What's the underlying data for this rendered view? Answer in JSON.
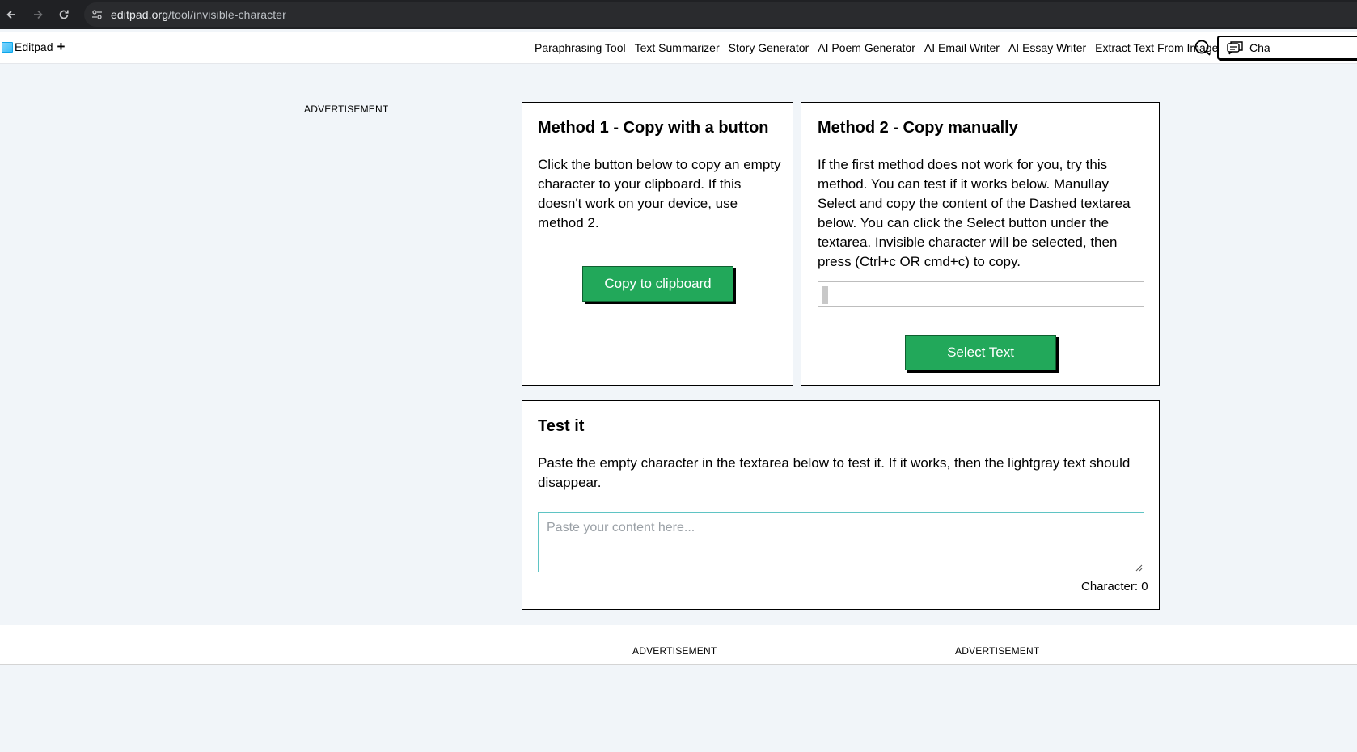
{
  "browser": {
    "url_host": "editpad.org",
    "url_path": "/tool/invisible-character"
  },
  "header": {
    "logo_text": "Editpad",
    "logo_plus": "+",
    "nav": [
      "Paraphrasing Tool",
      "Text Summarizer",
      "Story Generator",
      "AI Poem Generator",
      "AI Email Writer",
      "AI Essay Writer",
      "Extract Text From Image"
    ],
    "chat_label": "Cha"
  },
  "ads": {
    "left": "ADVERTISEMENT",
    "bottom_1": "ADVERTISEMENT",
    "bottom_2": "ADVERTISEMENT"
  },
  "method1": {
    "title": "Method 1 - Copy with a button",
    "body": "Click the button below to copy an empty character to your clipboard. If this doesn't work on your device, use method 2.",
    "button": "Copy to clipboard"
  },
  "method2": {
    "title": "Method 2 - Copy manually",
    "body": "If the first method does not work for you, try this method. You can test if it works below. Manullay Select and copy the content of the Dashed textarea below. You can click the Select button under the textarea. Invisible character will be selected, then press (Ctrl+c OR cmd+c) to copy.",
    "button": "Select Text"
  },
  "test": {
    "title": "Test it",
    "body": "Paste the empty character in the textarea below to test it. If it works, then the lightgray text should disappear.",
    "placeholder": "Paste your content here...",
    "char_count": "Character: 0"
  },
  "colors": {
    "accent_green": "#22a85a",
    "chrome_dark": "#202124",
    "page_bg": "#f1f5f9"
  }
}
